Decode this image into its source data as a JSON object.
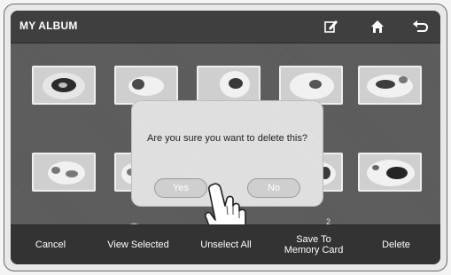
{
  "header": {
    "title": "MY ALBUM",
    "icons": [
      "edit-icon",
      "home-icon",
      "back-icon"
    ]
  },
  "dialog": {
    "message": "Are you sure you want to delete this?",
    "yes_label": "Yes",
    "no_label": "No"
  },
  "pager": {
    "text": "2"
  },
  "bottom_bar": {
    "buttons": [
      {
        "label": "Cancel"
      },
      {
        "label": "View Selected"
      },
      {
        "label": "Unselect All"
      },
      {
        "label": "Save To Memory Card"
      },
      {
        "label": "Delete"
      }
    ]
  },
  "colors": {
    "background": "#5a5a5a",
    "topbar": "#3f3f3f",
    "bottombar": "#333333",
    "dialog": "#e2e2e2"
  }
}
